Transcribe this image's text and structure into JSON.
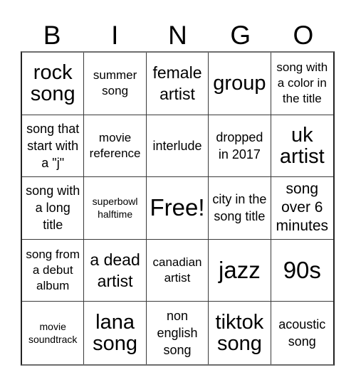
{
  "title_letters": [
    "B",
    "I",
    "N",
    "G",
    "O"
  ],
  "board": {
    "rows": [
      [
        {
          "text": "rock song",
          "size": "xl"
        },
        {
          "text": "summer song",
          "size": "s"
        },
        {
          "text": "female artist",
          "size": "l"
        },
        {
          "text": "group",
          "size": "xl"
        },
        {
          "text": "song with a color in the title",
          "size": "s"
        }
      ],
      [
        {
          "text": "song that start with a \"j\"",
          "size": "m"
        },
        {
          "text": "movie reference",
          "size": "s"
        },
        {
          "text": "interlude",
          "size": "m"
        },
        {
          "text": "dropped in 2017",
          "size": "m"
        },
        {
          "text": "uk artist",
          "size": "xl"
        }
      ],
      [
        {
          "text": "song with a long title",
          "size": "m"
        },
        {
          "text": "superbowl halftime",
          "size": "xs"
        },
        {
          "text": "Free!",
          "size": "xxl"
        },
        {
          "text": "city in the song title",
          "size": "m"
        },
        {
          "text": "song over 6 minutes",
          "size": "ml"
        }
      ],
      [
        {
          "text": "song from a debut album",
          "size": "s"
        },
        {
          "text": "a dead artist",
          "size": "l"
        },
        {
          "text": "canadian artist",
          "size": "s"
        },
        {
          "text": "jazz",
          "size": "xxl"
        },
        {
          "text": "90s",
          "size": "xxl"
        }
      ],
      [
        {
          "text": "movie soundtrack",
          "size": "xs"
        },
        {
          "text": "lana song",
          "size": "xl"
        },
        {
          "text": "non english song",
          "size": "m"
        },
        {
          "text": "tiktok song",
          "size": "xl"
        },
        {
          "text": "acoustic song",
          "size": "m"
        }
      ]
    ]
  },
  "colors": {
    "text": "#000000",
    "background": "#ffffff",
    "grid_line": "#3a3a3a"
  }
}
